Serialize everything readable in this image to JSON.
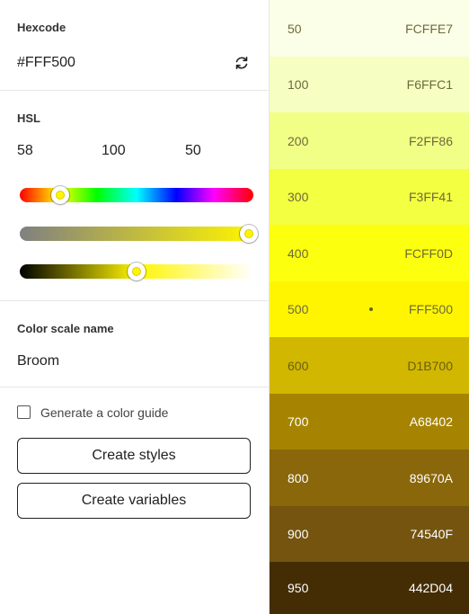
{
  "hexcode": {
    "label": "Hexcode",
    "value": "#FFF500"
  },
  "hsl": {
    "label": "HSL",
    "h": "58",
    "s": "100",
    "l": "50",
    "hue_level": 0.16,
    "saturation_level": 1.0,
    "lightness_level": 0.5
  },
  "scale_name": {
    "label": "Color scale name",
    "value": "Broom"
  },
  "guide": {
    "label": "Generate a color guide",
    "checked": false
  },
  "buttons": {
    "create_styles": "Create styles",
    "create_variables": "Create variables"
  },
  "icons": {
    "refresh": "refresh-icon"
  },
  "scale": [
    {
      "step": "50",
      "hex": "FCFFE7",
      "bg": "#FCFFE7",
      "fg": "#6b6a3c",
      "selected": false
    },
    {
      "step": "100",
      "hex": "F6FFC1",
      "bg": "#F6FFC1",
      "fg": "#6b6a3c",
      "selected": false
    },
    {
      "step": "200",
      "hex": "F2FF86",
      "bg": "#F2FF86",
      "fg": "#6b6a3c",
      "selected": false
    },
    {
      "step": "300",
      "hex": "F3FF41",
      "bg": "#F3FF41",
      "fg": "#6b6a3c",
      "selected": false
    },
    {
      "step": "400",
      "hex": "FCFF0D",
      "bg": "#FCFF0D",
      "fg": "#6b6a3c",
      "selected": false
    },
    {
      "step": "500",
      "hex": "FFF500",
      "bg": "#FFF500",
      "fg": "#6b6a3c",
      "selected": true
    },
    {
      "step": "600",
      "hex": "D1B700",
      "bg": "#D1B700",
      "fg": "#6b5e10",
      "selected": false
    },
    {
      "step": "700",
      "hex": "A68402",
      "bg": "#A68402",
      "fg": "#ffffff",
      "selected": false
    },
    {
      "step": "800",
      "hex": "89670A",
      "bg": "#89670A",
      "fg": "#ffffff",
      "selected": false
    },
    {
      "step": "900",
      "hex": "74540F",
      "bg": "#74540F",
      "fg": "#ffffff",
      "selected": false
    },
    {
      "step": "950",
      "hex": "442D04",
      "bg": "#442D04",
      "fg": "#ffffff",
      "selected": false
    }
  ]
}
